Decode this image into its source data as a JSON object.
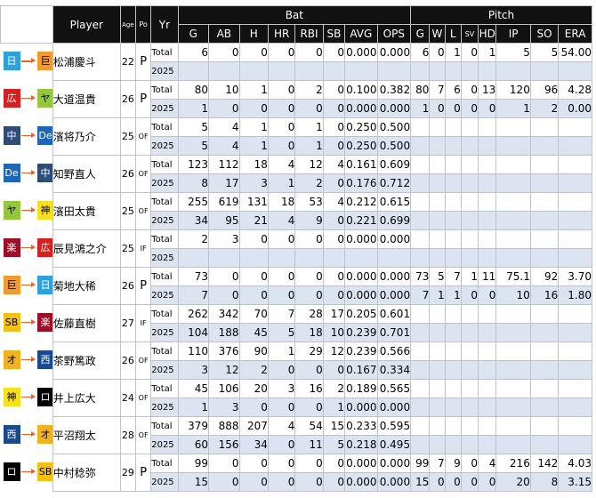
{
  "header": {
    "player": "Player",
    "age": "Age",
    "pos": "Po",
    "yr": "Yr",
    "bat_group": "Bat",
    "pitch_group": "Pitch",
    "bat_cols": [
      "G",
      "AB",
      "H",
      "HR",
      "RBI",
      "SB",
      "AVG",
      "OPS"
    ],
    "pitch_cols": [
      "G",
      "W",
      "L",
      "SV",
      "HD",
      "IP",
      "SO",
      "ERA"
    ]
  },
  "row_labels": {
    "total": "Total",
    "year": "2025"
  },
  "team_colors": {
    "日": {
      "bg": "#2da1dc",
      "fg": "#ffffff"
    },
    "巨": {
      "bg": "#f29a2e",
      "fg": "#000000"
    },
    "広": {
      "bg": "#d7211e",
      "fg": "#ffffff"
    },
    "ヤ": {
      "bg": "#94c73c",
      "fg": "#000000"
    },
    "中": {
      "bg": "#2f4b78",
      "fg": "#ffffff"
    },
    "De": {
      "bg": "#1f65b8",
      "fg": "#ffffff"
    },
    "神": {
      "bg": "#f7e01c",
      "fg": "#000000"
    },
    "楽": {
      "bg": "#9c0f26",
      "fg": "#ffffff"
    },
    "SB": {
      "bg": "#f5c111",
      "fg": "#000000"
    },
    "オ": {
      "bg": "#f2b21d",
      "fg": "#000000"
    },
    "西": {
      "bg": "#1a4a8e",
      "fg": "#ffffff"
    },
    "ロ": {
      "bg": "#000000",
      "fg": "#ffffff"
    }
  },
  "players": [
    {
      "from": "日",
      "to": "巨",
      "name": "松浦慶斗",
      "age": "22",
      "pos": "P",
      "total": {
        "bat": [
          "6",
          "0",
          "0",
          "0",
          "0",
          "0",
          "0.000",
          "0.000"
        ],
        "pitch": [
          "6",
          "0",
          "1",
          "0",
          "1",
          "5",
          "5",
          "54.00"
        ]
      },
      "year": {
        "bat": [
          "",
          "",
          "",
          "",
          "",
          "",
          "",
          ""
        ],
        "pitch": [
          "",
          "",
          "",
          "",
          "",
          "",
          "",
          ""
        ]
      }
    },
    {
      "from": "広",
      "to": "ヤ",
      "name": "大道温貴",
      "age": "26",
      "pos": "P",
      "total": {
        "bat": [
          "80",
          "10",
          "1",
          "0",
          "2",
          "0",
          "0.100",
          "0.382"
        ],
        "pitch": [
          "80",
          "7",
          "6",
          "0",
          "13",
          "120",
          "96",
          "4.28"
        ]
      },
      "year": {
        "bat": [
          "1",
          "0",
          "0",
          "0",
          "0",
          "0",
          "0.000",
          "0.000"
        ],
        "pitch": [
          "1",
          "0",
          "0",
          "0",
          "0",
          "1",
          "2",
          "0.00"
        ]
      }
    },
    {
      "from": "中",
      "to": "De",
      "name": "濱将乃介",
      "age": "25",
      "pos": "OF",
      "total": {
        "bat": [
          "5",
          "4",
          "1",
          "0",
          "1",
          "0",
          "0.250",
          "0.500"
        ],
        "pitch": [
          "",
          "",
          "",
          "",
          "",
          "",
          "",
          ""
        ]
      },
      "year": {
        "bat": [
          "5",
          "4",
          "1",
          "0",
          "1",
          "0",
          "0.250",
          "0.500"
        ],
        "pitch": [
          "",
          "",
          "",
          "",
          "",
          "",
          "",
          ""
        ]
      }
    },
    {
      "from": "De",
      "to": "中",
      "name": "知野直人",
      "age": "26",
      "pos": "OF",
      "total": {
        "bat": [
          "123",
          "112",
          "18",
          "4",
          "12",
          "4",
          "0.161",
          "0.609"
        ],
        "pitch": [
          "",
          "",
          "",
          "",
          "",
          "",
          "",
          ""
        ]
      },
      "year": {
        "bat": [
          "8",
          "17",
          "3",
          "1",
          "2",
          "0",
          "0.176",
          "0.712"
        ],
        "pitch": [
          "",
          "",
          "",
          "",
          "",
          "",
          "",
          ""
        ]
      }
    },
    {
      "from": "ヤ",
      "to": "神",
      "name": "濱田太貴",
      "age": "25",
      "pos": "OF",
      "total": {
        "bat": [
          "255",
          "619",
          "131",
          "18",
          "53",
          "4",
          "0.212",
          "0.615"
        ],
        "pitch": [
          "",
          "",
          "",
          "",
          "",
          "",
          "",
          ""
        ]
      },
      "year": {
        "bat": [
          "34",
          "95",
          "21",
          "4",
          "9",
          "0",
          "0.221",
          "0.699"
        ],
        "pitch": [
          "",
          "",
          "",
          "",
          "",
          "",
          "",
          ""
        ]
      }
    },
    {
      "from": "楽",
      "to": "広",
      "name": "辰見鴻之介",
      "age": "25",
      "pos": "IF",
      "total": {
        "bat": [
          "2",
          "3",
          "0",
          "0",
          "0",
          "0",
          "0.000",
          "0.000"
        ],
        "pitch": [
          "",
          "",
          "",
          "",
          "",
          "",
          "",
          ""
        ]
      },
      "year": {
        "bat": [
          "",
          "",
          "",
          "",
          "",
          "",
          "",
          ""
        ],
        "pitch": [
          "",
          "",
          "",
          "",
          "",
          "",
          "",
          ""
        ]
      }
    },
    {
      "from": "巨",
      "to": "日",
      "name": "菊地大稀",
      "age": "26",
      "pos": "P",
      "total": {
        "bat": [
          "73",
          "0",
          "0",
          "0",
          "0",
          "0",
          "0.000",
          "0.000"
        ],
        "pitch": [
          "73",
          "5",
          "7",
          "1",
          "11",
          "75.1",
          "92",
          "3.70"
        ]
      },
      "year": {
        "bat": [
          "7",
          "0",
          "0",
          "0",
          "0",
          "0",
          "0.000",
          "0.000"
        ],
        "pitch": [
          "7",
          "1",
          "1",
          "0",
          "0",
          "10",
          "16",
          "1.80"
        ]
      }
    },
    {
      "from": "SB",
      "to": "楽",
      "name": "佐藤直樹",
      "age": "27",
      "pos": "IF",
      "total": {
        "bat": [
          "262",
          "342",
          "70",
          "7",
          "28",
          "17",
          "0.205",
          "0.601"
        ],
        "pitch": [
          "",
          "",
          "",
          "",
          "",
          "",
          "",
          ""
        ]
      },
      "year": {
        "bat": [
          "104",
          "188",
          "45",
          "5",
          "18",
          "10",
          "0.239",
          "0.701"
        ],
        "pitch": [
          "",
          "",
          "",
          "",
          "",
          "",
          "",
          ""
        ]
      }
    },
    {
      "from": "オ",
      "to": "西",
      "name": "茶野篤政",
      "age": "26",
      "pos": "OF",
      "total": {
        "bat": [
          "110",
          "376",
          "90",
          "1",
          "29",
          "12",
          "0.239",
          "0.566"
        ],
        "pitch": [
          "",
          "",
          "",
          "",
          "",
          "",
          "",
          ""
        ]
      },
      "year": {
        "bat": [
          "3",
          "12",
          "2",
          "0",
          "0",
          "0",
          "0.167",
          "0.334"
        ],
        "pitch": [
          "",
          "",
          "",
          "",
          "",
          "",
          "",
          ""
        ]
      }
    },
    {
      "from": "神",
      "to": "ロ",
      "name": "井上広大",
      "age": "24",
      "pos": "OF",
      "total": {
        "bat": [
          "45",
          "106",
          "20",
          "3",
          "16",
          "2",
          "0.189",
          "0.565"
        ],
        "pitch": [
          "",
          "",
          "",
          "",
          "",
          "",
          "",
          ""
        ]
      },
      "year": {
        "bat": [
          "1",
          "3",
          "0",
          "0",
          "0",
          "1",
          "0.000",
          "0.000"
        ],
        "pitch": [
          "",
          "",
          "",
          "",
          "",
          "",
          "",
          ""
        ]
      }
    },
    {
      "from": "西",
      "to": "オ",
      "name": "平沼翔太",
      "age": "28",
      "pos": "OF",
      "total": {
        "bat": [
          "379",
          "888",
          "207",
          "4",
          "54",
          "15",
          "0.233",
          "0.595"
        ],
        "pitch": [
          "",
          "",
          "",
          "",
          "",
          "",
          "",
          ""
        ]
      },
      "year": {
        "bat": [
          "60",
          "156",
          "34",
          "0",
          "11",
          "5",
          "0.218",
          "0.495"
        ],
        "pitch": [
          "",
          "",
          "",
          "",
          "",
          "",
          "",
          ""
        ]
      }
    },
    {
      "from": "ロ",
      "to": "SB",
      "name": "中村稔弥",
      "age": "29",
      "pos": "P",
      "total": {
        "bat": [
          "99",
          "0",
          "0",
          "0",
          "0",
          "0",
          "0.000",
          "0.000"
        ],
        "pitch": [
          "99",
          "7",
          "9",
          "0",
          "4",
          "216",
          "142",
          "4.03"
        ]
      },
      "year": {
        "bat": [
          "15",
          "0",
          "0",
          "0",
          "0",
          "0",
          "0.000",
          "0.000"
        ],
        "pitch": [
          "15",
          "0",
          "0",
          "0",
          "0",
          "20",
          "8",
          "3.15"
        ]
      }
    }
  ]
}
